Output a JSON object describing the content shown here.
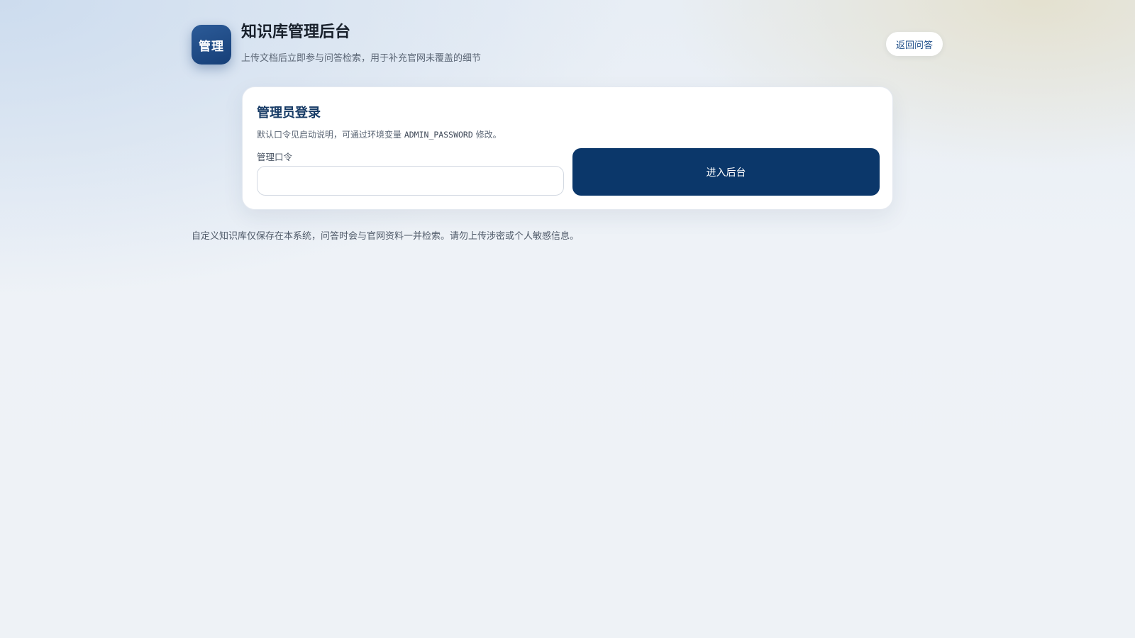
{
  "header": {
    "logo_text": "管理",
    "title": "知识库管理后台",
    "subtitle": "上传文档后立即参与问答检索，用于补充官网未覆盖的细节",
    "back_button": "返回问答"
  },
  "login": {
    "title": "管理员登录",
    "hint_prefix": "默认口令见启动说明，可通过环境变量 ",
    "hint_env": "ADMIN_PASSWORD",
    "hint_suffix": " 修改。",
    "password_label": "管理口令",
    "password_value": "",
    "password_placeholder": "",
    "submit_label": "进入后台"
  },
  "footer": {
    "note": "自定义知识库仅保存在本系统，问答时会与官网资料一并检索。请勿上传涉密或个人敏感信息。"
  },
  "colors": {
    "primary": "#0b376a",
    "logo": "#1d4a86",
    "link": "#1f4f8a"
  }
}
